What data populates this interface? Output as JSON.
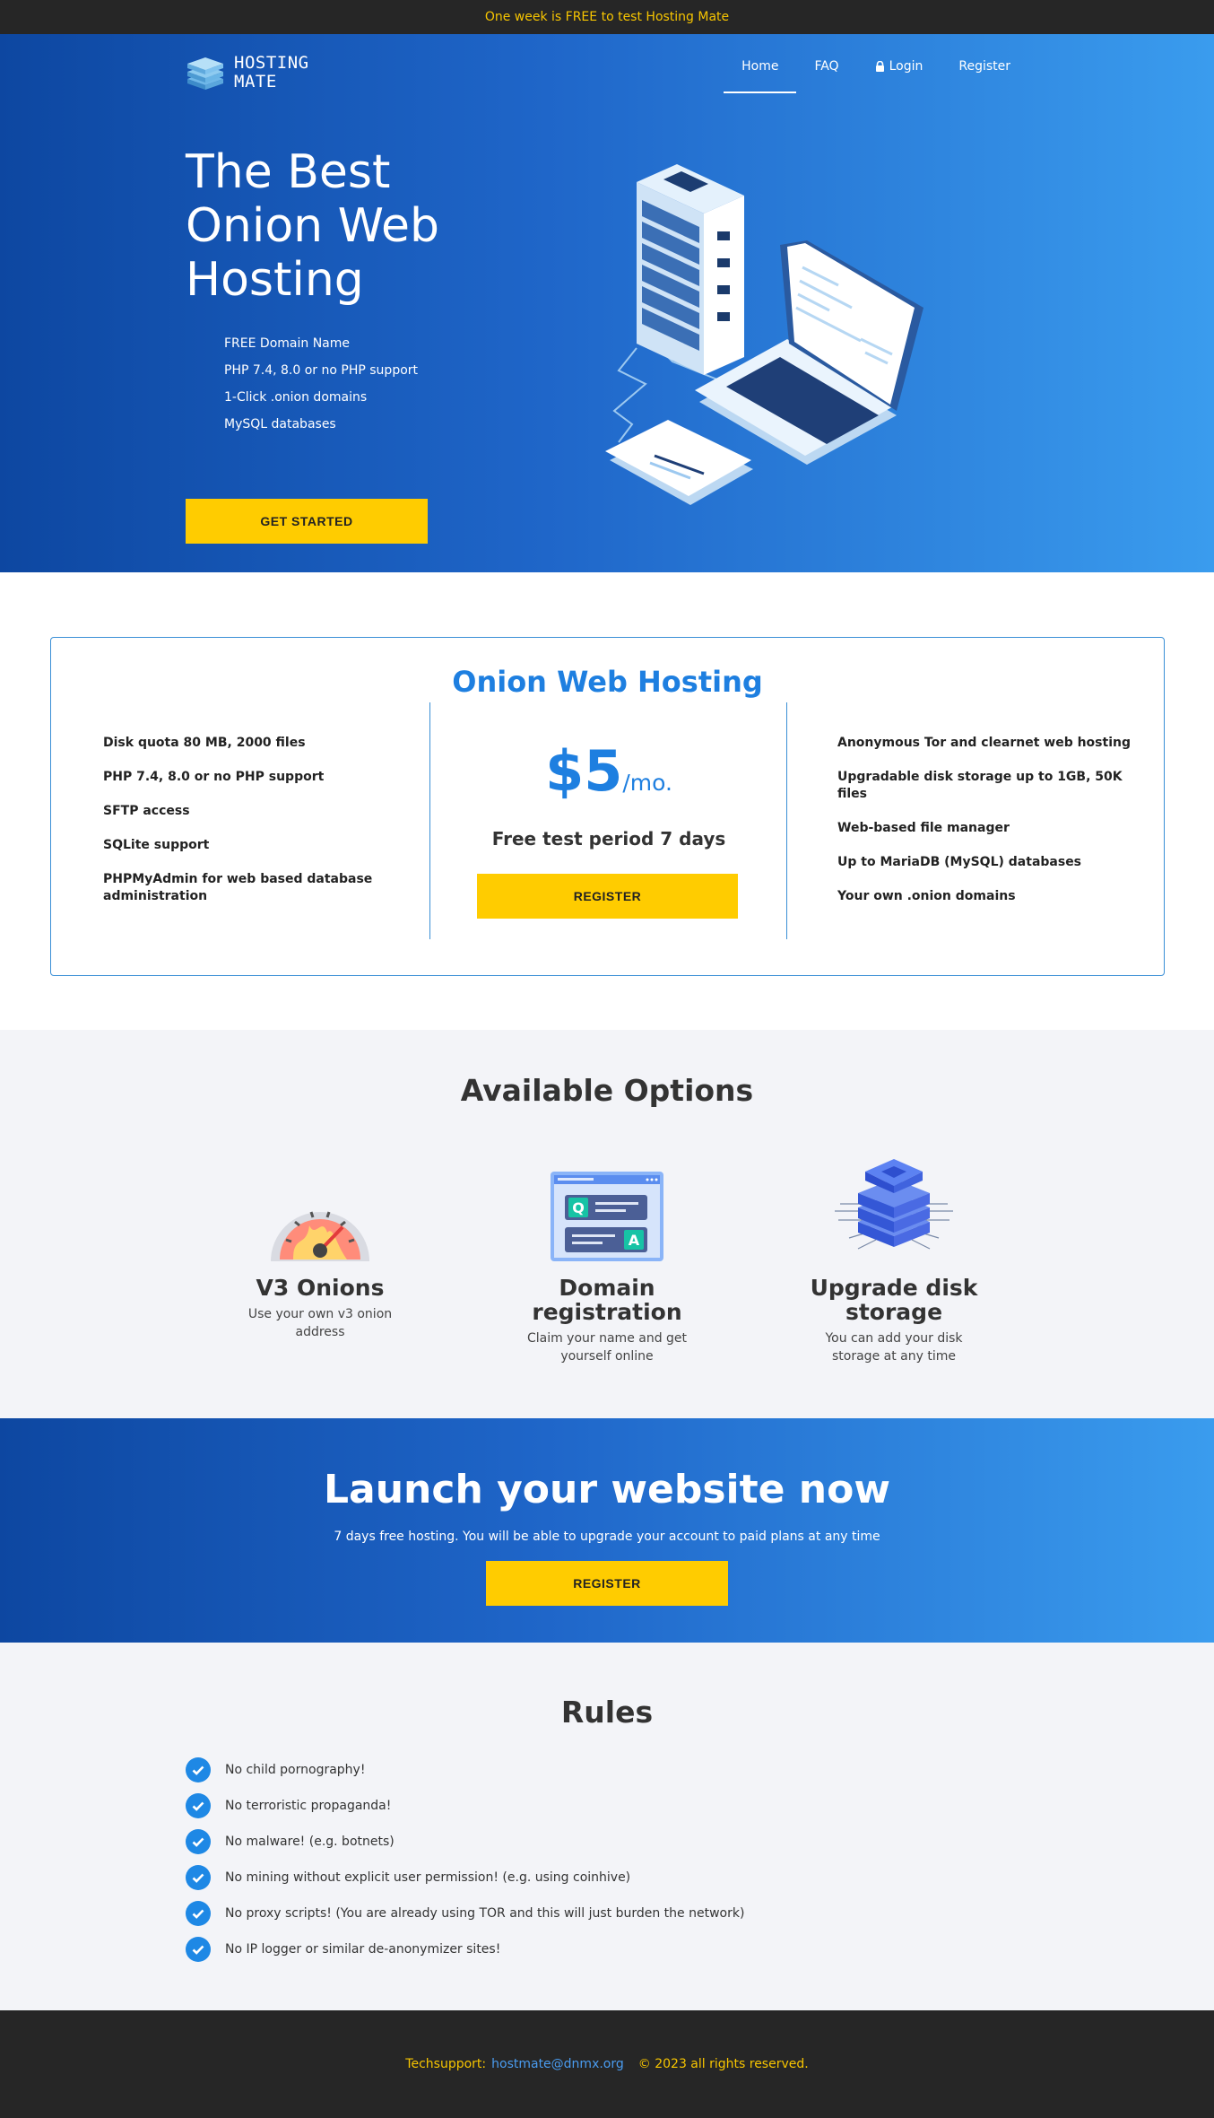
{
  "topbar": {
    "text": "One week is FREE to test Hosting Mate"
  },
  "brand": {
    "line1": "HOSTING",
    "line2": "MATE"
  },
  "nav": {
    "home": "Home",
    "faq": "FAQ",
    "login": "Login",
    "register": "Register"
  },
  "hero": {
    "title": "The Best Onion Web Hosting",
    "features": [
      "FREE Domain Name",
      "PHP 7.4, 8.0 or no PHP support",
      "1-Click .onion domains",
      "MySQL databases"
    ],
    "cta": "GET STARTED"
  },
  "pricing": {
    "title": "Onion Web Hosting",
    "left": [
      "Disk quota 80 MB, 2000 files",
      "PHP 7.4, 8.0 or no PHP support",
      "SFTP access",
      "SQLite support",
      "PHPMyAdmin for web based database administration"
    ],
    "price": "$5",
    "unit": "/mo.",
    "trial": "Free test period 7 days",
    "cta": "REGISTER",
    "right": [
      "Anonymous Tor and clearnet web hosting",
      "Upgradable disk storage up to 1GB, 50K files",
      "Web-based file manager",
      "Up to MariaDB (MySQL) databases",
      "Your own .onion domains"
    ]
  },
  "options": {
    "title": "Available Options",
    "items": [
      {
        "name": "V3 Onions",
        "desc": "Use your own v3 onion address",
        "icon": "speedometer-icon"
      },
      {
        "name": "Domain registration",
        "desc": "Claim your name and get yourself online",
        "icon": "qa-window-icon"
      },
      {
        "name": "Upgrade disk storage",
        "desc": "You can add your disk storage at any time",
        "icon": "server-stack-icon"
      }
    ]
  },
  "launch": {
    "title": "Launch your website now",
    "subtitle": "7 days free hosting. You will be able to upgrade your account to paid plans at any time",
    "cta": "REGISTER"
  },
  "rules": {
    "title": "Rules",
    "items": [
      "No child pornography!",
      "No terroristic propaganda!",
      "No malware! (e.g. botnets)",
      "No mining without explicit user permission! (e.g. using coinhive)",
      "No proxy scripts! (You are already using TOR and this will just burden the network)",
      "No IP logger or similar de-anonymizer sites!"
    ]
  },
  "footer": {
    "label": "Techsupport:",
    "email": "hostmate@dnmx.org",
    "copyright": "© 2023 all rights reserved."
  },
  "colors": {
    "accent": "#1e7fe0",
    "cta": "#ffcc00",
    "topbar_text": "#f7c500",
    "dark": "#262626"
  }
}
